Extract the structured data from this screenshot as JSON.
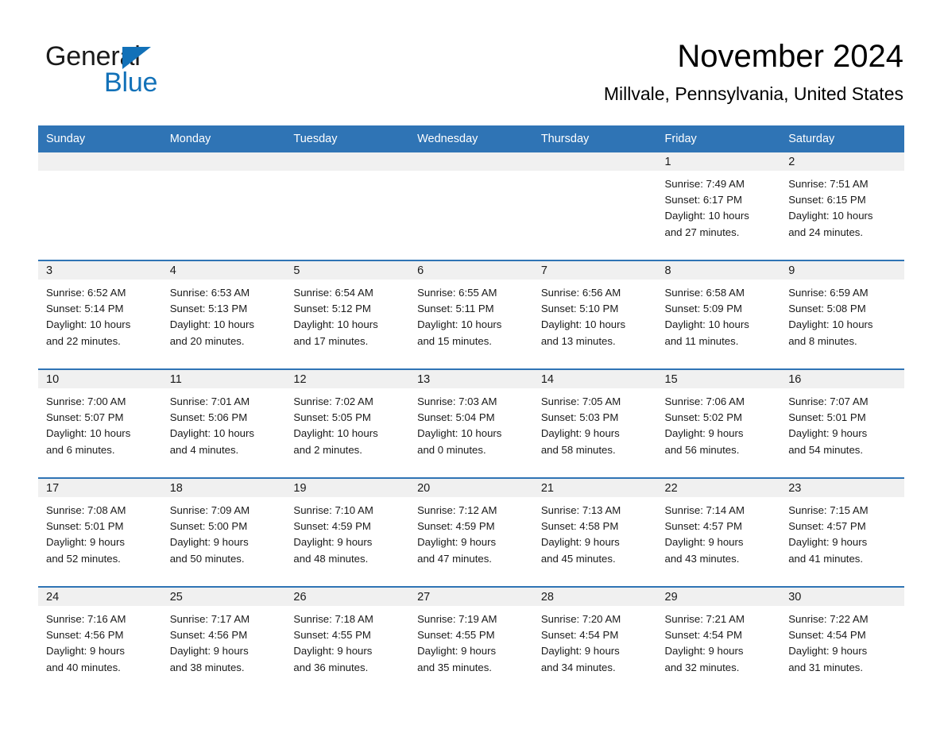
{
  "brand": {
    "name_part1": "General",
    "name_part2": "Blue",
    "triangle_icon": "triangle-icon",
    "color_dark": "#1a1a1a",
    "color_blue": "#1271b8"
  },
  "header": {
    "month_title": "November 2024",
    "location": "Millvale, Pennsylvania, United States"
  },
  "theme": {
    "header_blue": "#2f74b5",
    "day_band_gray": "#f0f0f0",
    "text": "#1a1a1a",
    "background": "#ffffff"
  },
  "calendar": {
    "weekday_headers": [
      "Sunday",
      "Monday",
      "Tuesday",
      "Wednesday",
      "Thursday",
      "Friday",
      "Saturday"
    ],
    "weeks": [
      [
        {
          "day": "",
          "sunrise": "",
          "sunset": "",
          "daylight_line1": "",
          "daylight_line2": "",
          "empty": true
        },
        {
          "day": "",
          "sunrise": "",
          "sunset": "",
          "daylight_line1": "",
          "daylight_line2": "",
          "empty": true
        },
        {
          "day": "",
          "sunrise": "",
          "sunset": "",
          "daylight_line1": "",
          "daylight_line2": "",
          "empty": true
        },
        {
          "day": "",
          "sunrise": "",
          "sunset": "",
          "daylight_line1": "",
          "daylight_line2": "",
          "empty": true
        },
        {
          "day": "",
          "sunrise": "",
          "sunset": "",
          "daylight_line1": "",
          "daylight_line2": "",
          "empty": true
        },
        {
          "day": "1",
          "sunrise": "Sunrise: 7:49 AM",
          "sunset": "Sunset: 6:17 PM",
          "daylight_line1": "Daylight: 10 hours",
          "daylight_line2": "and 27 minutes.",
          "empty": false
        },
        {
          "day": "2",
          "sunrise": "Sunrise: 7:51 AM",
          "sunset": "Sunset: 6:15 PM",
          "daylight_line1": "Daylight: 10 hours",
          "daylight_line2": "and 24 minutes.",
          "empty": false
        }
      ],
      [
        {
          "day": "3",
          "sunrise": "Sunrise: 6:52 AM",
          "sunset": "Sunset: 5:14 PM",
          "daylight_line1": "Daylight: 10 hours",
          "daylight_line2": "and 22 minutes.",
          "empty": false
        },
        {
          "day": "4",
          "sunrise": "Sunrise: 6:53 AM",
          "sunset": "Sunset: 5:13 PM",
          "daylight_line1": "Daylight: 10 hours",
          "daylight_line2": "and 20 minutes.",
          "empty": false
        },
        {
          "day": "5",
          "sunrise": "Sunrise: 6:54 AM",
          "sunset": "Sunset: 5:12 PM",
          "daylight_line1": "Daylight: 10 hours",
          "daylight_line2": "and 17 minutes.",
          "empty": false
        },
        {
          "day": "6",
          "sunrise": "Sunrise: 6:55 AM",
          "sunset": "Sunset: 5:11 PM",
          "daylight_line1": "Daylight: 10 hours",
          "daylight_line2": "and 15 minutes.",
          "empty": false
        },
        {
          "day": "7",
          "sunrise": "Sunrise: 6:56 AM",
          "sunset": "Sunset: 5:10 PM",
          "daylight_line1": "Daylight: 10 hours",
          "daylight_line2": "and 13 minutes.",
          "empty": false
        },
        {
          "day": "8",
          "sunrise": "Sunrise: 6:58 AM",
          "sunset": "Sunset: 5:09 PM",
          "daylight_line1": "Daylight: 10 hours",
          "daylight_line2": "and 11 minutes.",
          "empty": false
        },
        {
          "day": "9",
          "sunrise": "Sunrise: 6:59 AM",
          "sunset": "Sunset: 5:08 PM",
          "daylight_line1": "Daylight: 10 hours",
          "daylight_line2": "and 8 minutes.",
          "empty": false
        }
      ],
      [
        {
          "day": "10",
          "sunrise": "Sunrise: 7:00 AM",
          "sunset": "Sunset: 5:07 PM",
          "daylight_line1": "Daylight: 10 hours",
          "daylight_line2": "and 6 minutes.",
          "empty": false
        },
        {
          "day": "11",
          "sunrise": "Sunrise: 7:01 AM",
          "sunset": "Sunset: 5:06 PM",
          "daylight_line1": "Daylight: 10 hours",
          "daylight_line2": "and 4 minutes.",
          "empty": false
        },
        {
          "day": "12",
          "sunrise": "Sunrise: 7:02 AM",
          "sunset": "Sunset: 5:05 PM",
          "daylight_line1": "Daylight: 10 hours",
          "daylight_line2": "and 2 minutes.",
          "empty": false
        },
        {
          "day": "13",
          "sunrise": "Sunrise: 7:03 AM",
          "sunset": "Sunset: 5:04 PM",
          "daylight_line1": "Daylight: 10 hours",
          "daylight_line2": "and 0 minutes.",
          "empty": false
        },
        {
          "day": "14",
          "sunrise": "Sunrise: 7:05 AM",
          "sunset": "Sunset: 5:03 PM",
          "daylight_line1": "Daylight: 9 hours",
          "daylight_line2": "and 58 minutes.",
          "empty": false
        },
        {
          "day": "15",
          "sunrise": "Sunrise: 7:06 AM",
          "sunset": "Sunset: 5:02 PM",
          "daylight_line1": "Daylight: 9 hours",
          "daylight_line2": "and 56 minutes.",
          "empty": false
        },
        {
          "day": "16",
          "sunrise": "Sunrise: 7:07 AM",
          "sunset": "Sunset: 5:01 PM",
          "daylight_line1": "Daylight: 9 hours",
          "daylight_line2": "and 54 minutes.",
          "empty": false
        }
      ],
      [
        {
          "day": "17",
          "sunrise": "Sunrise: 7:08 AM",
          "sunset": "Sunset: 5:01 PM",
          "daylight_line1": "Daylight: 9 hours",
          "daylight_line2": "and 52 minutes.",
          "empty": false
        },
        {
          "day": "18",
          "sunrise": "Sunrise: 7:09 AM",
          "sunset": "Sunset: 5:00 PM",
          "daylight_line1": "Daylight: 9 hours",
          "daylight_line2": "and 50 minutes.",
          "empty": false
        },
        {
          "day": "19",
          "sunrise": "Sunrise: 7:10 AM",
          "sunset": "Sunset: 4:59 PM",
          "daylight_line1": "Daylight: 9 hours",
          "daylight_line2": "and 48 minutes.",
          "empty": false
        },
        {
          "day": "20",
          "sunrise": "Sunrise: 7:12 AM",
          "sunset": "Sunset: 4:59 PM",
          "daylight_line1": "Daylight: 9 hours",
          "daylight_line2": "and 47 minutes.",
          "empty": false
        },
        {
          "day": "21",
          "sunrise": "Sunrise: 7:13 AM",
          "sunset": "Sunset: 4:58 PM",
          "daylight_line1": "Daylight: 9 hours",
          "daylight_line2": "and 45 minutes.",
          "empty": false
        },
        {
          "day": "22",
          "sunrise": "Sunrise: 7:14 AM",
          "sunset": "Sunset: 4:57 PM",
          "daylight_line1": "Daylight: 9 hours",
          "daylight_line2": "and 43 minutes.",
          "empty": false
        },
        {
          "day": "23",
          "sunrise": "Sunrise: 7:15 AM",
          "sunset": "Sunset: 4:57 PM",
          "daylight_line1": "Daylight: 9 hours",
          "daylight_line2": "and 41 minutes.",
          "empty": false
        }
      ],
      [
        {
          "day": "24",
          "sunrise": "Sunrise: 7:16 AM",
          "sunset": "Sunset: 4:56 PM",
          "daylight_line1": "Daylight: 9 hours",
          "daylight_line2": "and 40 minutes.",
          "empty": false
        },
        {
          "day": "25",
          "sunrise": "Sunrise: 7:17 AM",
          "sunset": "Sunset: 4:56 PM",
          "daylight_line1": "Daylight: 9 hours",
          "daylight_line2": "and 38 minutes.",
          "empty": false
        },
        {
          "day": "26",
          "sunrise": "Sunrise: 7:18 AM",
          "sunset": "Sunset: 4:55 PM",
          "daylight_line1": "Daylight: 9 hours",
          "daylight_line2": "and 36 minutes.",
          "empty": false
        },
        {
          "day": "27",
          "sunrise": "Sunrise: 7:19 AM",
          "sunset": "Sunset: 4:55 PM",
          "daylight_line1": "Daylight: 9 hours",
          "daylight_line2": "and 35 minutes.",
          "empty": false
        },
        {
          "day": "28",
          "sunrise": "Sunrise: 7:20 AM",
          "sunset": "Sunset: 4:54 PM",
          "daylight_line1": "Daylight: 9 hours",
          "daylight_line2": "and 34 minutes.",
          "empty": false
        },
        {
          "day": "29",
          "sunrise": "Sunrise: 7:21 AM",
          "sunset": "Sunset: 4:54 PM",
          "daylight_line1": "Daylight: 9 hours",
          "daylight_line2": "and 32 minutes.",
          "empty": false
        },
        {
          "day": "30",
          "sunrise": "Sunrise: 7:22 AM",
          "sunset": "Sunset: 4:54 PM",
          "daylight_line1": "Daylight: 9 hours",
          "daylight_line2": "and 31 minutes.",
          "empty": false
        }
      ]
    ]
  }
}
